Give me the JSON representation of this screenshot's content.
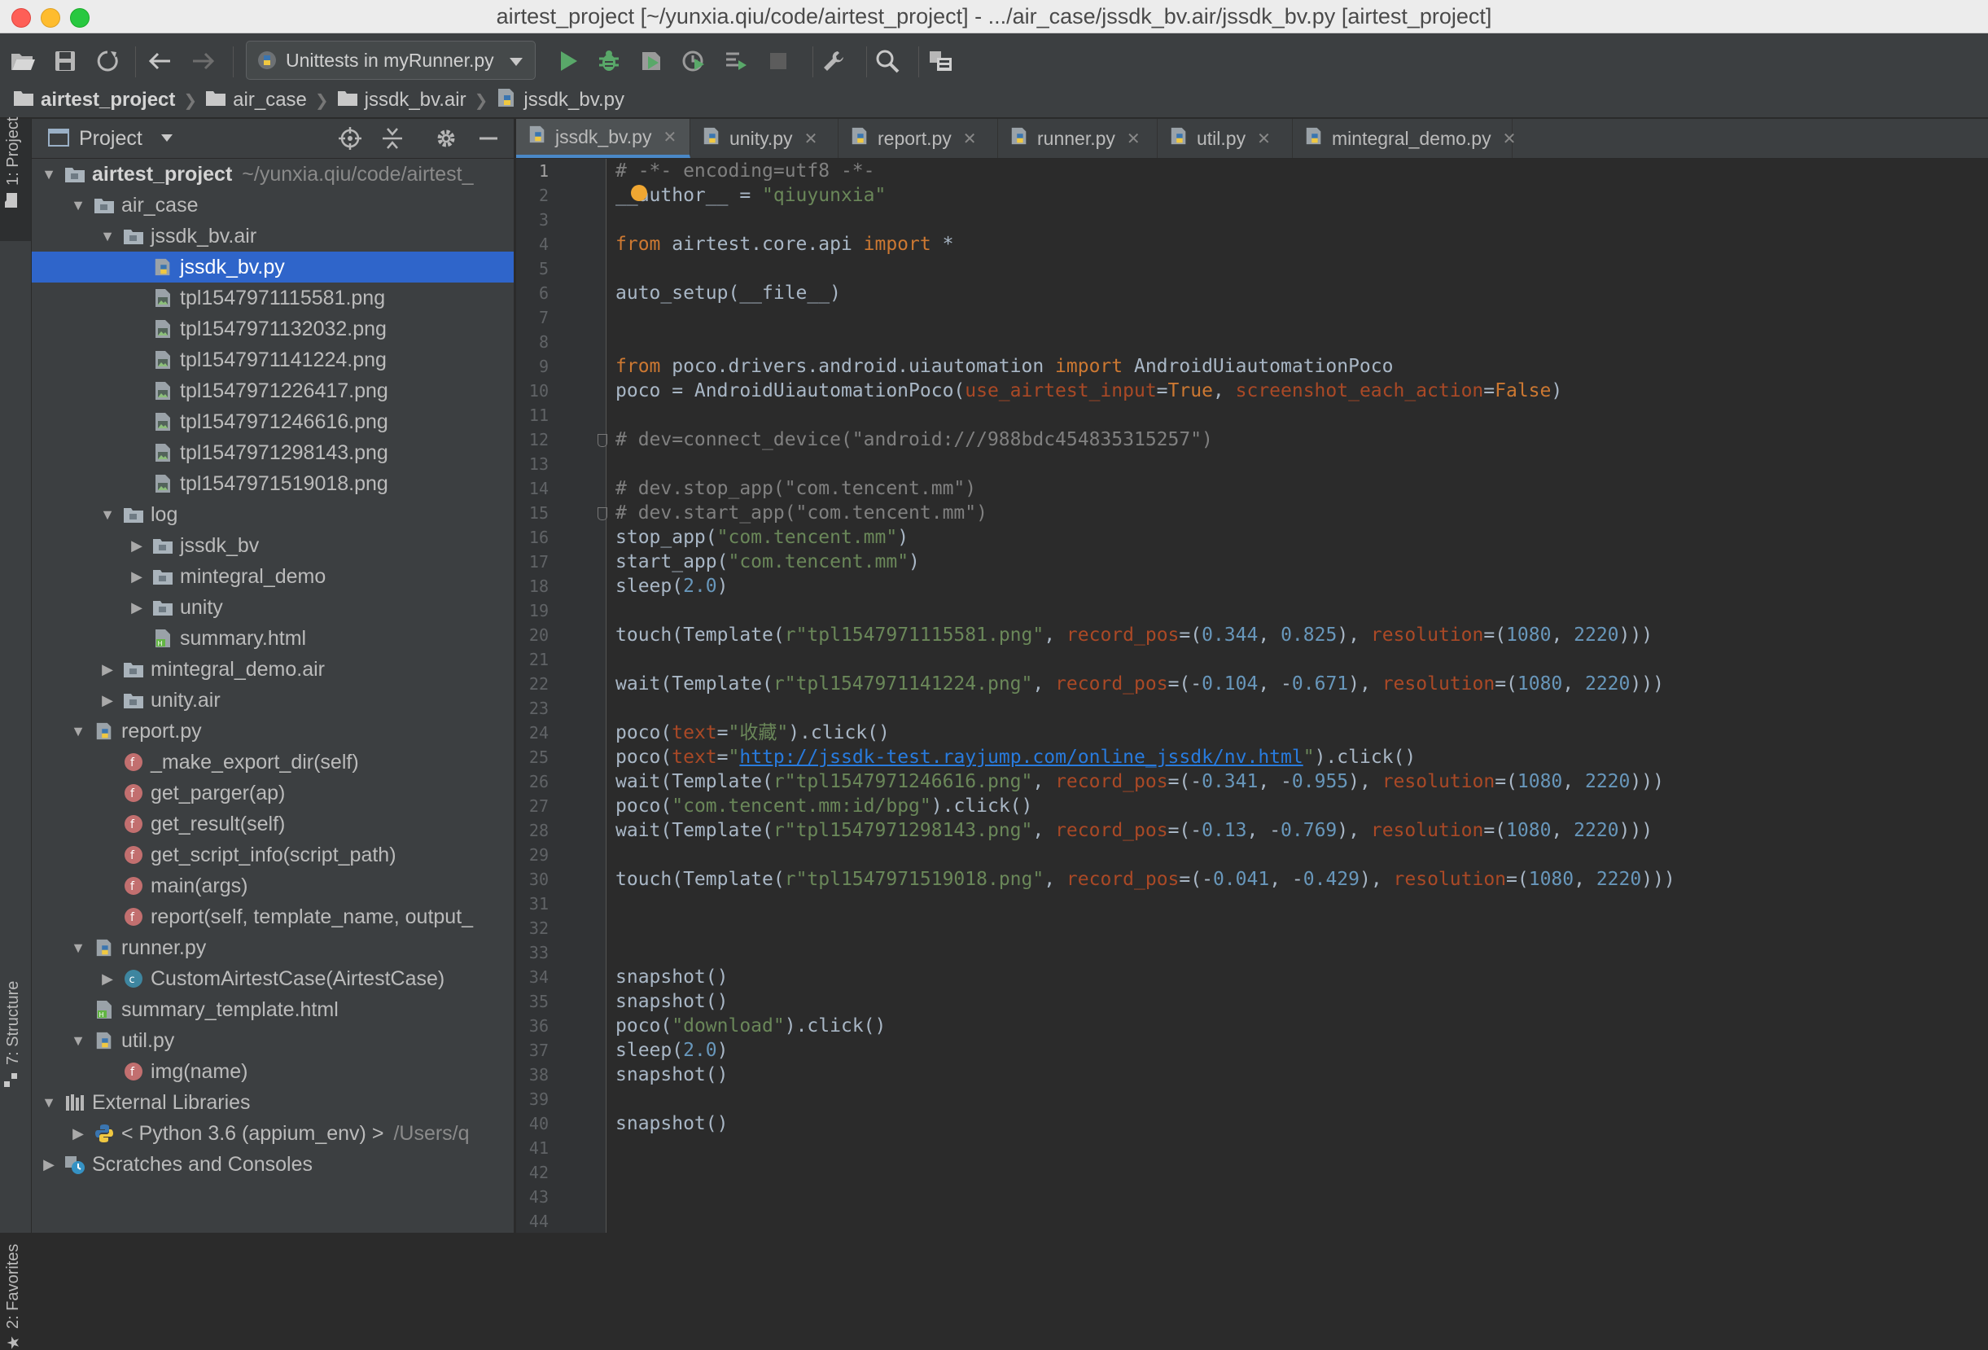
{
  "window": {
    "title": "airtest_project [~/yunxia.qiu/code/airtest_project] - .../air_case/jssdk_bv.air/jssdk_bv.py [airtest_project]"
  },
  "toolbar": {
    "run_config": "Unittests in myRunner.py",
    "icons": [
      "open-folder-icon",
      "save-icon",
      "sync-icon",
      "back-arrow-icon",
      "forward-arrow-icon",
      "run-icon",
      "debug-icon",
      "coverage-icon",
      "profile-icon",
      "concurrency-icon",
      "stop-icon",
      "wrench-icon",
      "search-icon",
      "sdk-manager-icon"
    ],
    "colors": {
      "run": "#59a869",
      "debug": "#59a869"
    }
  },
  "breadcrumb": [
    {
      "label": "airtest_project",
      "bold": true
    },
    {
      "label": "air_case"
    },
    {
      "label": "jssdk_bv.air"
    },
    {
      "label": "jssdk_bv.py"
    }
  ],
  "stripe": {
    "project_tab": "1: Project",
    "structure_tab": "7: Structure",
    "favorites_tab": "2: Favorites"
  },
  "project_panel": {
    "title": "Project",
    "tree": [
      {
        "indent": 0,
        "arrow": "down",
        "icon": "folder",
        "label": "airtest_project",
        "bold": true,
        "extra": "~/yunxia.qiu/code/airtest_"
      },
      {
        "indent": 1,
        "arrow": "down",
        "icon": "folder",
        "label": "air_case"
      },
      {
        "indent": 2,
        "arrow": "down",
        "icon": "folder",
        "label": "jssdk_bv.air"
      },
      {
        "indent": 3,
        "arrow": "",
        "icon": "python",
        "label": "jssdk_bv.py",
        "selected": true
      },
      {
        "indent": 3,
        "arrow": "",
        "icon": "image",
        "label": "tpl1547971115581.png"
      },
      {
        "indent": 3,
        "arrow": "",
        "icon": "image",
        "label": "tpl1547971132032.png"
      },
      {
        "indent": 3,
        "arrow": "",
        "icon": "image",
        "label": "tpl1547971141224.png"
      },
      {
        "indent": 3,
        "arrow": "",
        "icon": "image",
        "label": "tpl1547971226417.png"
      },
      {
        "indent": 3,
        "arrow": "",
        "icon": "image",
        "label": "tpl1547971246616.png"
      },
      {
        "indent": 3,
        "arrow": "",
        "icon": "image",
        "label": "tpl1547971298143.png"
      },
      {
        "indent": 3,
        "arrow": "",
        "icon": "image",
        "label": "tpl1547971519018.png"
      },
      {
        "indent": 2,
        "arrow": "down",
        "icon": "folder",
        "label": "log"
      },
      {
        "indent": 3,
        "arrow": "right",
        "icon": "folder",
        "label": "jssdk_bv"
      },
      {
        "indent": 3,
        "arrow": "right",
        "icon": "folder",
        "label": "mintegral_demo"
      },
      {
        "indent": 3,
        "arrow": "right",
        "icon": "folder",
        "label": "unity"
      },
      {
        "indent": 3,
        "arrow": "",
        "icon": "html",
        "label": "summary.html"
      },
      {
        "indent": 2,
        "arrow": "right",
        "icon": "folder",
        "label": "mintegral_demo.air"
      },
      {
        "indent": 2,
        "arrow": "right",
        "icon": "folder",
        "label": "unity.air"
      },
      {
        "indent": 1,
        "arrow": "down",
        "icon": "python",
        "label": "report.py"
      },
      {
        "indent": 2,
        "arrow": "",
        "icon": "function",
        "label": "_make_export_dir(self)"
      },
      {
        "indent": 2,
        "arrow": "",
        "icon": "function",
        "label": "get_parger(ap)"
      },
      {
        "indent": 2,
        "arrow": "",
        "icon": "function",
        "label": "get_result(self)"
      },
      {
        "indent": 2,
        "arrow": "",
        "icon": "function",
        "label": "get_script_info(script_path)"
      },
      {
        "indent": 2,
        "arrow": "",
        "icon": "function",
        "label": "main(args)"
      },
      {
        "indent": 2,
        "arrow": "",
        "icon": "function",
        "label": "report(self, template_name, output_"
      },
      {
        "indent": 1,
        "arrow": "down",
        "icon": "python",
        "label": "runner.py"
      },
      {
        "indent": 2,
        "arrow": "right",
        "icon": "class",
        "label": "CustomAirtestCase(AirtestCase)"
      },
      {
        "indent": 1,
        "arrow": "",
        "icon": "html",
        "label": "summary_template.html"
      },
      {
        "indent": 1,
        "arrow": "down",
        "icon": "python",
        "label": "util.py"
      },
      {
        "indent": 2,
        "arrow": "",
        "icon": "function",
        "label": "img(name)"
      },
      {
        "indent": 0,
        "arrow": "down",
        "icon": "library",
        "label": "External Libraries"
      },
      {
        "indent": 1,
        "arrow": "right",
        "icon": "python-sdk",
        "label": "< Python 3.6 (appium_env) >",
        "extra": "/Users/q"
      },
      {
        "indent": 0,
        "arrow": "right",
        "icon": "scratches",
        "label": "Scratches and Consoles"
      }
    ]
  },
  "editor": {
    "tabs": [
      {
        "label": "jssdk_bv.py",
        "active": true
      },
      {
        "label": "unity.py"
      },
      {
        "label": "report.py"
      },
      {
        "label": "runner.py"
      },
      {
        "label": "util.py"
      },
      {
        "label": "mintegral_demo.py"
      }
    ],
    "line_numbers": [
      "1",
      "2",
      "3",
      "4",
      "5",
      "6",
      "7",
      "8",
      "9",
      "10",
      "11",
      "12",
      "13",
      "14",
      "15",
      "16",
      "17",
      "18",
      "19",
      "20",
      "21",
      "22",
      "23",
      "24",
      "25",
      "26",
      "27",
      "28",
      "29",
      "30",
      "31",
      "32",
      "33",
      "34",
      "35",
      "36",
      "37",
      "38",
      "39",
      "40",
      "41",
      "42",
      "43",
      "44"
    ],
    "lines": [
      [
        [
          "c",
          "# -*- encoding=utf8 -*-"
        ]
      ],
      [
        [
          "p",
          "__author__ = "
        ],
        [
          "s",
          "\"qiuyunxia\""
        ]
      ],
      [],
      [
        [
          "k",
          "from"
        ],
        [
          "p",
          " airtest.core.api "
        ],
        [
          "k",
          "import"
        ],
        [
          "p",
          " *"
        ]
      ],
      [],
      [
        [
          "p",
          "auto_setup(__file__)"
        ]
      ],
      [],
      [],
      [
        [
          "k",
          "from"
        ],
        [
          "p",
          " poco.drivers.android.uiautomation "
        ],
        [
          "k",
          "import"
        ],
        [
          "p",
          " AndroidUiautomationPoco"
        ]
      ],
      [
        [
          "p",
          "poco = AndroidUiautomationPoco("
        ],
        [
          "a",
          "use_airtest_input"
        ],
        [
          "p",
          "="
        ],
        [
          "k",
          "True"
        ],
        [
          "p",
          ", "
        ],
        [
          "a",
          "screenshot_each_action"
        ],
        [
          "p",
          "="
        ],
        [
          "k",
          "False"
        ],
        [
          "p",
          ")"
        ]
      ],
      [],
      [
        [
          "c",
          "# dev=connect_device(\"android:///988bdc454835315257\")"
        ]
      ],
      [],
      [
        [
          "c",
          "# dev.stop_app(\"com.tencent.mm\")"
        ]
      ],
      [
        [
          "c",
          "# dev.start_app(\"com.tencent.mm\")"
        ]
      ],
      [
        [
          "p",
          "stop_app("
        ],
        [
          "s",
          "\"com.tencent.mm\""
        ],
        [
          "p",
          ")"
        ]
      ],
      [
        [
          "p",
          "start_app("
        ],
        [
          "s",
          "\"com.tencent.mm\""
        ],
        [
          "p",
          ")"
        ]
      ],
      [
        [
          "p",
          "sleep("
        ],
        [
          "n",
          "2.0"
        ],
        [
          "p",
          ")"
        ]
      ],
      [],
      [
        [
          "p",
          "touch(Template("
        ],
        [
          "s",
          "r\"tpl1547971115581.png\""
        ],
        [
          "p",
          ", "
        ],
        [
          "a",
          "record_pos"
        ],
        [
          "p",
          "=("
        ],
        [
          "n",
          "0.344"
        ],
        [
          "p",
          ", "
        ],
        [
          "n",
          "0.825"
        ],
        [
          "p",
          "), "
        ],
        [
          "a",
          "resolution"
        ],
        [
          "p",
          "=("
        ],
        [
          "n",
          "1080"
        ],
        [
          "p",
          ", "
        ],
        [
          "n",
          "2220"
        ],
        [
          "p",
          ")))"
        ]
      ],
      [],
      [
        [
          "p",
          "wait(Template("
        ],
        [
          "s",
          "r\"tpl1547971141224.png\""
        ],
        [
          "p",
          ", "
        ],
        [
          "a",
          "record_pos"
        ],
        [
          "p",
          "=(-"
        ],
        [
          "n",
          "0.104"
        ],
        [
          "p",
          ", -"
        ],
        [
          "n",
          "0.671"
        ],
        [
          "p",
          "), "
        ],
        [
          "a",
          "resolution"
        ],
        [
          "p",
          "=("
        ],
        [
          "n",
          "1080"
        ],
        [
          "p",
          ", "
        ],
        [
          "n",
          "2220"
        ],
        [
          "p",
          ")))"
        ]
      ],
      [],
      [
        [
          "p",
          "poco("
        ],
        [
          "a",
          "text"
        ],
        [
          "p",
          "="
        ],
        [
          "s",
          "\"收藏\""
        ],
        [
          "p",
          ").click()"
        ]
      ],
      [
        [
          "p",
          "poco("
        ],
        [
          "a",
          "text"
        ],
        [
          "p",
          "="
        ],
        [
          "s",
          "\""
        ],
        [
          "l",
          "http://jssdk-test.rayjump.com/online_jssdk/nv.html"
        ],
        [
          "s",
          "\""
        ],
        [
          "p",
          ").click()"
        ]
      ],
      [
        [
          "p",
          "wait(Template("
        ],
        [
          "s",
          "r\"tpl1547971246616.png\""
        ],
        [
          "p",
          ", "
        ],
        [
          "a",
          "record_pos"
        ],
        [
          "p",
          "=(-"
        ],
        [
          "n",
          "0.341"
        ],
        [
          "p",
          ", -"
        ],
        [
          "n",
          "0.955"
        ],
        [
          "p",
          "), "
        ],
        [
          "a",
          "resolution"
        ],
        [
          "p",
          "=("
        ],
        [
          "n",
          "1080"
        ],
        [
          "p",
          ", "
        ],
        [
          "n",
          "2220"
        ],
        [
          "p",
          ")))"
        ]
      ],
      [
        [
          "p",
          "poco("
        ],
        [
          "s",
          "\"com.tencent.mm:id/bpg\""
        ],
        [
          "p",
          ").click()"
        ]
      ],
      [
        [
          "p",
          "wait(Template("
        ],
        [
          "s",
          "r\"tpl1547971298143.png\""
        ],
        [
          "p",
          ", "
        ],
        [
          "a",
          "record_pos"
        ],
        [
          "p",
          "=(-"
        ],
        [
          "n",
          "0.13"
        ],
        [
          "p",
          ", -"
        ],
        [
          "n",
          "0.769"
        ],
        [
          "p",
          "), "
        ],
        [
          "a",
          "resolution"
        ],
        [
          "p",
          "=("
        ],
        [
          "n",
          "1080"
        ],
        [
          "p",
          ", "
        ],
        [
          "n",
          "2220"
        ],
        [
          "p",
          ")))"
        ]
      ],
      [],
      [
        [
          "p",
          "touch(Template("
        ],
        [
          "s",
          "r\"tpl1547971519018.png\""
        ],
        [
          "p",
          ", "
        ],
        [
          "a",
          "record_pos"
        ],
        [
          "p",
          "=(-"
        ],
        [
          "n",
          "0.041"
        ],
        [
          "p",
          ", -"
        ],
        [
          "n",
          "0.429"
        ],
        [
          "p",
          "), "
        ],
        [
          "a",
          "resolution"
        ],
        [
          "p",
          "=("
        ],
        [
          "n",
          "1080"
        ],
        [
          "p",
          ", "
        ],
        [
          "n",
          "2220"
        ],
        [
          "p",
          ")))"
        ]
      ],
      [],
      [],
      [],
      [
        [
          "p",
          "snapshot()"
        ]
      ],
      [
        [
          "p",
          "snapshot()"
        ]
      ],
      [
        [
          "p",
          "poco("
        ],
        [
          "s",
          "\"download\""
        ],
        [
          "p",
          ").click()"
        ]
      ],
      [
        [
          "p",
          "sleep("
        ],
        [
          "n",
          "2.0"
        ],
        [
          "p",
          ")"
        ]
      ],
      [
        [
          "p",
          "snapshot()"
        ]
      ],
      [],
      [
        [
          "p",
          "snapshot()"
        ]
      ],
      [],
      [],
      [],
      []
    ]
  }
}
